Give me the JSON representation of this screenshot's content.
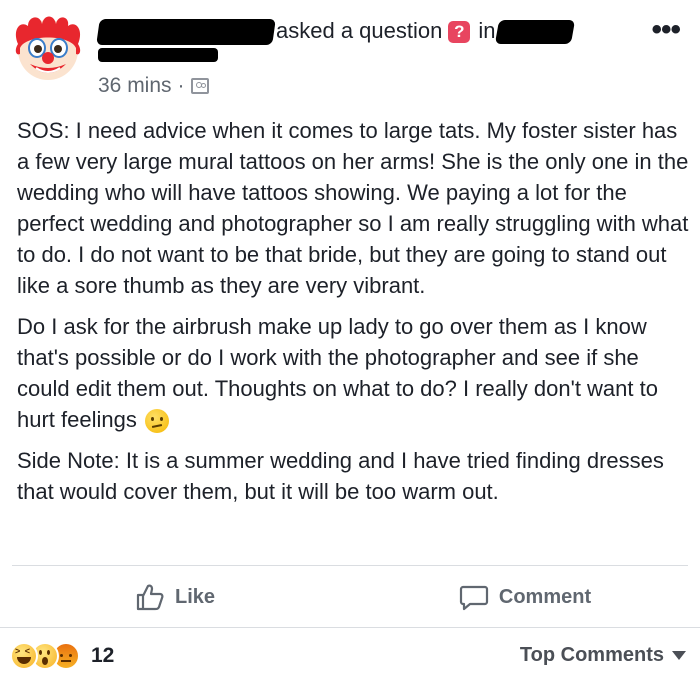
{
  "header": {
    "action_text": "asked a question",
    "question_badge": "?",
    "in_text": "in",
    "more_icon": "more-horizontal-icon"
  },
  "meta": {
    "time": "36 mins",
    "separator": "·",
    "audience_icon": "group-icon"
  },
  "avatar": {
    "icon": "clown-face-icon"
  },
  "post": {
    "paragraph1": "SOS: I need advice when it comes to large tats. My foster sister has a few very large mural tattoos on her arms! She is the only one in the wedding who will have tattoos showing. We paying a lot for the perfect wedding and photographer so I am really struggling with what to do. I do not want to be that bride, but they are going to stand out like a sore thumb as they are very vibrant.",
    "paragraph2": "Do I ask for the airbrush make up lady to go over them as I know that's possible or do I work with the photographer and see if she could edit them out. Thoughts on what to do? I really don't want to hurt feelings",
    "paragraph2_emoji": "confused-face-icon",
    "paragraph3": "Side Note: It is a summer wedding and I have tried finding dresses that would cover them, but it will be too warm out."
  },
  "actions": {
    "like_label": "Like",
    "comment_label": "Comment"
  },
  "footer": {
    "reaction_icons": [
      "haha-reaction-icon",
      "wow-reaction-icon",
      "angry-reaction-icon"
    ],
    "reaction_count": "12",
    "sort_label": "Top Comments"
  },
  "colors": {
    "text": "#1d2129",
    "muted": "#606770",
    "divider": "#dadde1",
    "question_badge": "#e8455f"
  }
}
